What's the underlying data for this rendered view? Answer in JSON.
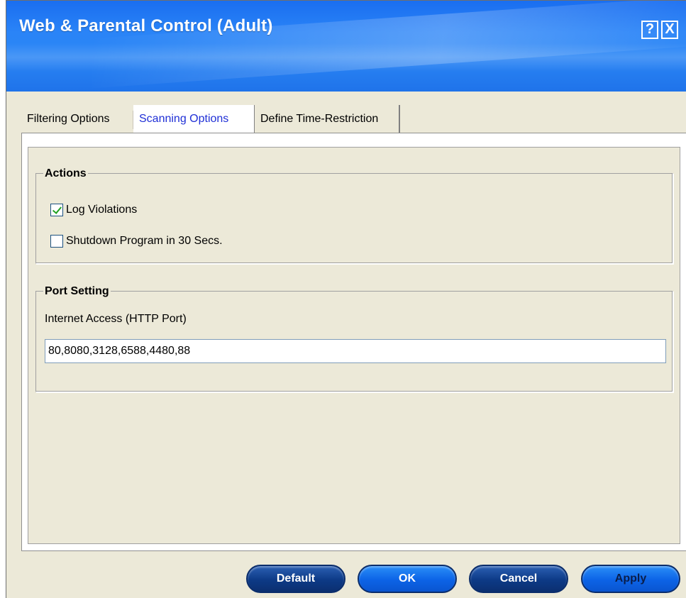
{
  "window": {
    "title": "Web & Parental Control (Adult)",
    "help_label": "?",
    "close_label": "X"
  },
  "tabs": [
    {
      "label": "Filtering Options",
      "active": false
    },
    {
      "label": "Scanning Options",
      "active": true
    },
    {
      "label": "Define Time-Restriction",
      "active": false
    }
  ],
  "actions_group": {
    "legend": "Actions",
    "options": [
      {
        "label": "Log Violations",
        "checked": true
      },
      {
        "label": "Shutdown Program in 30 Secs.",
        "checked": false
      }
    ]
  },
  "port_group": {
    "legend": "Port Setting",
    "field_label": "Internet Access (HTTP Port)",
    "field_value": "80,8080,3128,6588,4480,88"
  },
  "buttons": {
    "default": "Default",
    "ok": "OK",
    "cancel": "Cancel",
    "apply": "Apply"
  },
  "colors": {
    "titlebar": "#2a84f7",
    "active_tab_text": "#1f2fd6",
    "button_dark": "#0d3a86",
    "button_bright": "#0c63e6",
    "check_mark": "#21a121"
  }
}
